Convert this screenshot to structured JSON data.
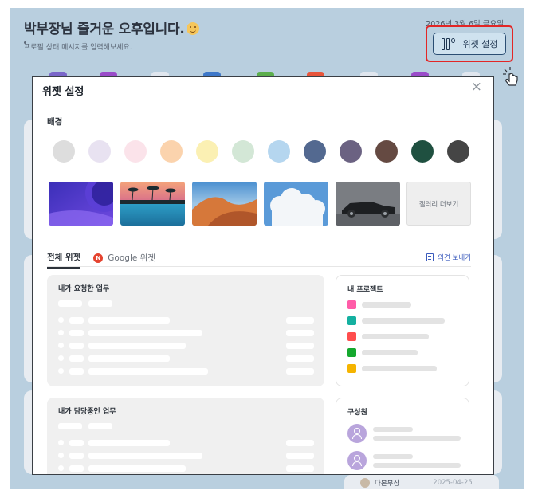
{
  "header": {
    "greeting": "박부장님 즐거운 오후입니다.",
    "status_placeholder": "프로필 상태 메시지를 입력해보세요.",
    "date": "2026년 3월 6일 금요일",
    "settings_label": "위젯 설정"
  },
  "background_peek": {
    "user_name": "다본부장",
    "user_date": "2025-04-25"
  },
  "modal": {
    "title": "위젯 설정",
    "close": "×",
    "background_section": "배경",
    "colors": [
      "#dddddd",
      "#e8e2f1",
      "#fbe3ea",
      "#fbd3ad",
      "#fbf0b3",
      "#d3e7d6",
      "#b5d6ef",
      "#536990",
      "#6b6282",
      "#654a42",
      "#1f5040",
      "#454545"
    ],
    "gallery_more": "갤러리 더보기",
    "tabs": [
      "전체 위젯",
      "Google 위젯"
    ],
    "google_badge": "N",
    "feedback": "의견 보내기",
    "widgets": {
      "requested": "내가 요청한 업무",
      "assigned": "내가 담당중인 업무",
      "projects": "내 프로젝트",
      "members": "구성원"
    },
    "project_colors": [
      "#ff5ca8",
      "#14b0a0",
      "#ff4d4d",
      "#14a82e",
      "#f5b400"
    ]
  }
}
